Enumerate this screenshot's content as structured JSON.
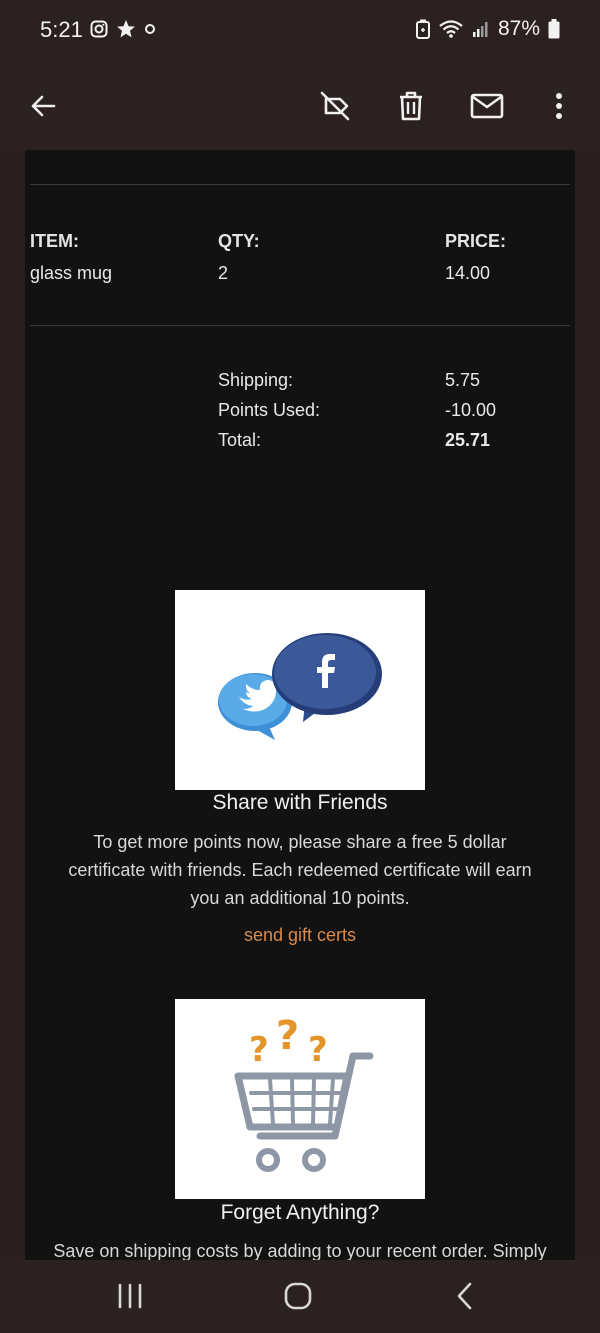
{
  "status_bar": {
    "time": "5:21",
    "battery": "87%",
    "left_icons": [
      "instagram-icon",
      "star-icon",
      "circle-icon"
    ],
    "right_icons": [
      "battery-saver-icon",
      "wifi-icon",
      "signal-icon",
      "battery-icon"
    ]
  },
  "app_bar": {
    "icons": [
      "back-arrow-icon",
      "label-off-icon",
      "delete-icon",
      "mark-unread-icon",
      "more-vert-icon"
    ]
  },
  "order": {
    "headers": {
      "item": "ITEM:",
      "qty": "QTY:",
      "price": "PRICE:"
    },
    "rows": [
      {
        "item": "glass mug",
        "qty": "2",
        "price": "14.00"
      }
    ],
    "summary": {
      "shipping_label": "Shipping:",
      "shipping_value": "5.75",
      "points_label": "Points Used:",
      "points_value": "-10.00",
      "total_label": "Total:",
      "total_value": "25.71"
    }
  },
  "share_section": {
    "image_icons": [
      "facebook-icon",
      "twitter-icon"
    ],
    "title": "Share with Friends",
    "text_line1": "To get more points now, please share a free 5 dollar",
    "text_line2": "certificate with friends. Each redeemed certificate will earn",
    "text_line3": "you an additional 10 points.",
    "link": "send gift certs",
    "link_color": "#d98a4b"
  },
  "forget_section": {
    "image_icons": [
      "shopping-cart-icon",
      "question-marks-icon"
    ],
    "title": "Forget Anything?",
    "text_partial": "Save on shipping costs by adding to your recent order. Simply"
  },
  "nav_bar": {
    "icons": [
      "recents-icon",
      "home-icon",
      "back-icon"
    ]
  }
}
